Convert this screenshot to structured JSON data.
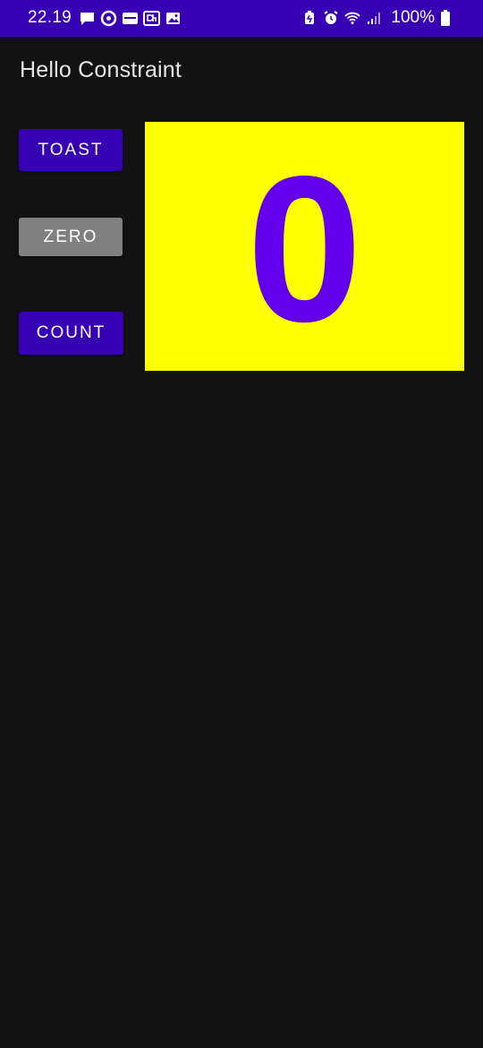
{
  "status_bar": {
    "time": "22.19",
    "battery": "100%",
    "notification_icons": [
      "chat-bubble-icon",
      "circle-app-icon",
      "app-badge-icon",
      "dh-app-icon",
      "gallery-icon"
    ],
    "system_icons": [
      "battery-saver-icon",
      "alarm-icon",
      "wifi-icon",
      "signal-icon",
      "battery-icon"
    ],
    "background_color": "#3700B3"
  },
  "app": {
    "title": "Hello Constraint"
  },
  "buttons": {
    "toast_label": "TOAST",
    "zero_label": "ZERO",
    "count_label": "COUNT"
  },
  "counter": {
    "value": "0",
    "background_color": "#FFFF00",
    "text_color": "#6200EE"
  }
}
